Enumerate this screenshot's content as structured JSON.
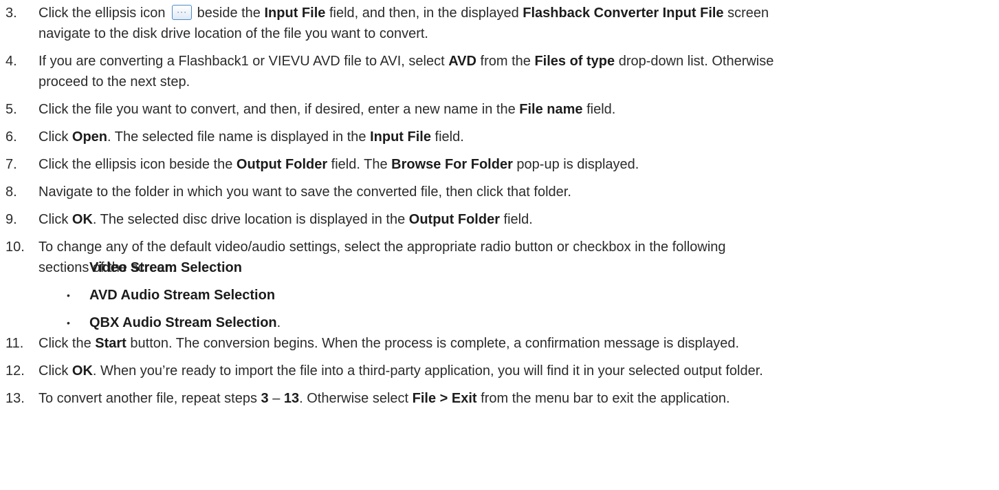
{
  "steps": [
    {
      "num": "3.",
      "lines": [
        [
          {
            "t": "Click the ellipsis icon "
          },
          {
            "icon": "ellipsis-icon"
          },
          {
            "t": " beside the "
          },
          {
            "b": "Input File"
          },
          {
            "t": " field, and then, in the displayed "
          },
          {
            "b": "Flashback Converter Input File"
          },
          {
            "t": " screen"
          }
        ],
        [
          {
            "t": "navigate to the disk drive location of the file you want to convert."
          }
        ]
      ]
    },
    {
      "num": "4.",
      "lines": [
        [
          {
            "t": "If you are converting a Flashback1 or VIEVU AVD file to AVI, select "
          },
          {
            "b": "AVD"
          },
          {
            "t": " from the "
          },
          {
            "b": "Files of type"
          },
          {
            "t": " drop-down list. Otherwise"
          }
        ],
        [
          {
            "t": "proceed to the next step."
          }
        ]
      ]
    },
    {
      "num": "5.",
      "lines": [
        [
          {
            "t": "Click the file you want to convert, and then, if desired, enter a new name in the "
          },
          {
            "b": "File name"
          },
          {
            "t": " field."
          }
        ]
      ]
    },
    {
      "num": "6.",
      "lines": [
        [
          {
            "t": "Click "
          },
          {
            "b": "Open"
          },
          {
            "t": ". The selected file name is displayed in the "
          },
          {
            "b": "Input File"
          },
          {
            "t": " field."
          }
        ]
      ]
    },
    {
      "num": "7.",
      "lines": [
        [
          {
            "t": "Click the ellipsis icon beside the "
          },
          {
            "b": "Output Folder"
          },
          {
            "t": " field. The "
          },
          {
            "b": "Browse For Folder"
          },
          {
            "t": " pop-up is displayed."
          }
        ]
      ]
    },
    {
      "num": "8.",
      "lines": [
        [
          {
            "t": "Navigate to the folder in which you want to save the converted file, then click that folder."
          }
        ]
      ]
    },
    {
      "num": "9.",
      "lines": [
        [
          {
            "t": "Click "
          },
          {
            "b": "OK"
          },
          {
            "t": ". The selected disc drive location is displayed in the "
          },
          {
            "b": "Output Folder"
          },
          {
            "t": " field."
          }
        ]
      ]
    },
    {
      "num": "10.",
      "lines": [
        [
          {
            "t": "To change any of the default video/audio settings, select the appropriate radio button or checkbox in the following"
          }
        ],
        [
          {
            "t": "sections of the screen:"
          }
        ]
      ]
    },
    {
      "num": "11.",
      "lines": [
        [
          {
            "t": "Click the "
          },
          {
            "b": "Start"
          },
          {
            "t": " button. The conversion begins. When the process is complete, a confirmation message is displayed."
          }
        ]
      ]
    },
    {
      "num": "12.",
      "lines": [
        [
          {
            "t": "Click "
          },
          {
            "b": "OK"
          },
          {
            "t": ". When you’re ready to import the file into a third-party application, you will find it in your selected output folder."
          }
        ]
      ]
    },
    {
      "num": "13.",
      "lines": [
        [
          {
            "t": "To convert another file, repeat steps "
          },
          {
            "b": "3"
          },
          {
            "t": " – "
          },
          {
            "b": "13"
          },
          {
            "t": ". Otherwise select "
          },
          {
            "b": "File > Exit"
          },
          {
            "t": " from the menu bar to exit the application."
          }
        ]
      ]
    }
  ],
  "sub_items": [
    [
      {
        "b": "Video Stream Selection"
      }
    ],
    [
      {
        "b": "AVD Audio Stream Selection"
      }
    ],
    [
      {
        "b": "QBX Audio Stream Selection"
      },
      {
        "t": "."
      }
    ]
  ],
  "bullet_char": "•",
  "ellipsis_glyph": "···"
}
